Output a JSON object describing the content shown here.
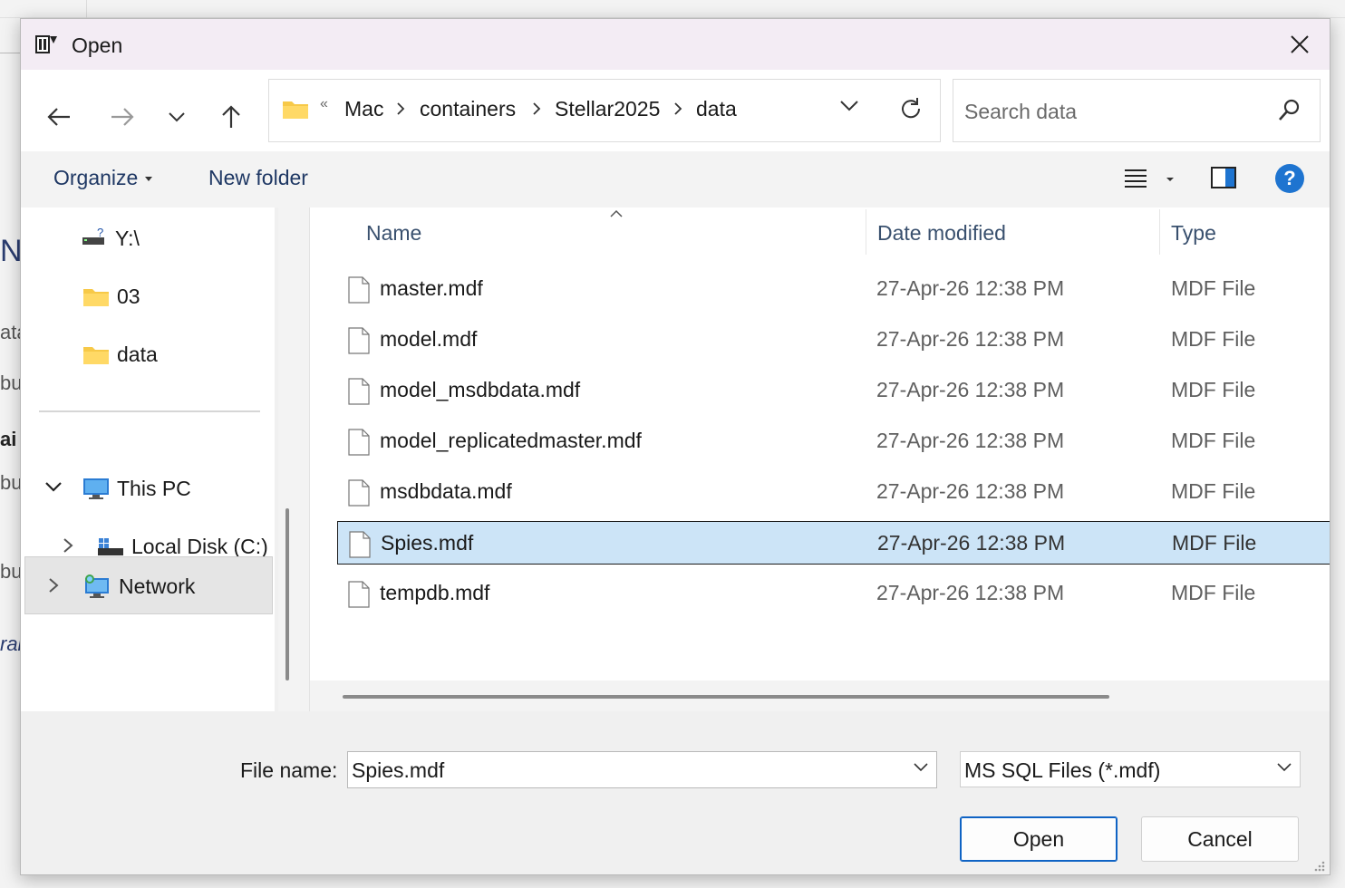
{
  "dialog": {
    "title": "Open",
    "close_icon": "close-icon"
  },
  "nav": {
    "back_icon": "arrow-left-icon",
    "forward_icon": "arrow-right-icon",
    "recent_icon": "chevron-down-icon",
    "up_icon": "arrow-up-icon"
  },
  "address": {
    "overflow_chevron": "«",
    "crumbs": [
      "Mac",
      "containers",
      "Stellar2025",
      "data"
    ]
  },
  "search": {
    "placeholder": "Search data"
  },
  "commandbar": {
    "organize": "Organize",
    "new_folder": "New folder"
  },
  "sidebar": {
    "items": [
      {
        "label": "Y:\\",
        "icon": "network-drive-icon"
      },
      {
        "label": "03",
        "icon": "folder-icon"
      },
      {
        "label": "data",
        "icon": "folder-icon"
      },
      {
        "label": "This PC",
        "icon": "computer-icon",
        "expanded": true
      },
      {
        "label": "Local Disk (C:)",
        "icon": "disk-icon",
        "expanded": false
      },
      {
        "label": "Network",
        "icon": "network-icon",
        "expanded": false,
        "selected": true
      }
    ]
  },
  "columns": {
    "name": "Name",
    "date": "Date modified",
    "type": "Type"
  },
  "files": [
    {
      "name": "master.mdf",
      "date": "27-Apr-26 12:38 PM",
      "type": "MDF File",
      "selected": false
    },
    {
      "name": "model.mdf",
      "date": "27-Apr-26 12:38 PM",
      "type": "MDF File",
      "selected": false
    },
    {
      "name": "model_msdbdata.mdf",
      "date": "27-Apr-26 12:38 PM",
      "type": "MDF File",
      "selected": false
    },
    {
      "name": "model_replicatedmaster.mdf",
      "date": "27-Apr-26 12:38 PM",
      "type": "MDF File",
      "selected": false
    },
    {
      "name": "msdbdata.mdf",
      "date": "27-Apr-26 12:38 PM",
      "type": "MDF File",
      "selected": false
    },
    {
      "name": "Spies.mdf",
      "date": "27-Apr-26 12:38 PM",
      "type": "MDF File",
      "selected": true
    },
    {
      "name": "tempdb.mdf",
      "date": "27-Apr-26 12:38 PM",
      "type": "MDF File",
      "selected": false
    }
  ],
  "footer": {
    "file_name_label": "File name:",
    "file_name_value": "Spies.mdf",
    "file_type": "MS SQL Files (*.mdf)",
    "open": "Open",
    "cancel": "Cancel"
  },
  "background": {
    "fragments": [
      "N",
      "ata",
      "bu",
      "ai",
      "bu",
      "bu",
      "ran"
    ]
  },
  "colors": {
    "accent": "#1e74d0",
    "selection": "#cce4f7",
    "title_bg": "#f3ecf4"
  }
}
